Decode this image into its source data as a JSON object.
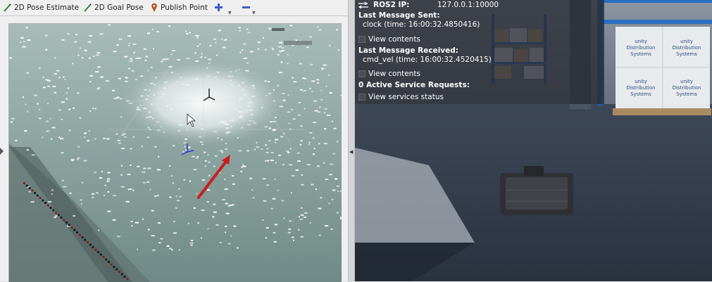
{
  "toolbar": {
    "pose_estimate": "2D Pose Estimate",
    "goal_pose": "2D Goal Pose",
    "publish_point": "Publish Point"
  },
  "hud": {
    "ros_ip_label": "ROS2 IP:",
    "ros_ip_value": "127.0.0.1:10000",
    "last_sent_label": "Last Message Sent:",
    "last_sent_value": "clock (time: 16:00:32.4850416)",
    "view_contents_1": "View contents",
    "last_received_label": "Last Message Received:",
    "last_received_value": "cmd_vel (time: 16:00:32.4520415)",
    "view_contents_2": "View contents",
    "active_services": "0 Active Service Requests:",
    "view_services": "View services status"
  },
  "scene": {
    "placards": [
      {
        "brand": "unity",
        "line1": "Distribution",
        "line2": "Systems"
      },
      {
        "brand": "unity",
        "line1": "Distribution",
        "line2": "Systems"
      },
      {
        "brand": "unity",
        "line1": "Distribution",
        "line2": "Systems"
      },
      {
        "brand": "unity",
        "line1": "Distribution",
        "line2": "Systems"
      }
    ]
  },
  "colors": {
    "accent_goal": "#2a8a2a",
    "publish_pin": "#b5531e",
    "zoom_icons": "#3a5fc4",
    "arrow_red": "#c81e1e",
    "rack_blue": "#1e5aa8"
  }
}
